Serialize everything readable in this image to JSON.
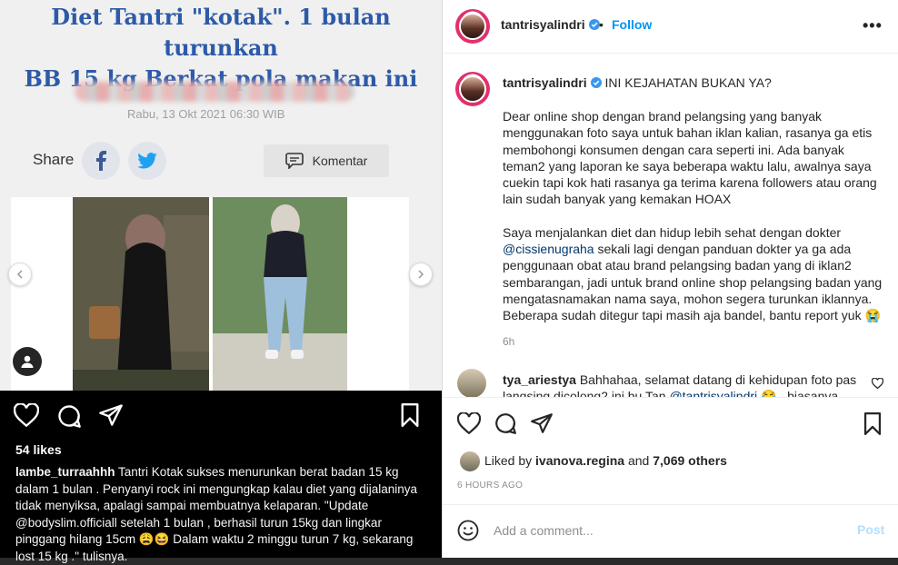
{
  "article": {
    "title_line1": "Diet Tantri \"kotak\". 1 bulan turunkan",
    "title_line2": "BB 15 kg Berkat pola makan ini",
    "date": "Rabu, 13 Okt 2021 06:30 WIB",
    "share_label": "Share",
    "komentar_label": "Komentar"
  },
  "left_post": {
    "likes": "54 likes",
    "caption_user": "lambe_turraahhh",
    "caption_text": " Tantri Kotak sukses menurunkan berat badan 15 kg dalam 1 bulan . Penyanyi rock ini mengungkap kalau diet yang dijalaninya tidak menyiksa, apalagi sampai membuatnya kelaparan. \"Update @bodyslim.officiall setelah 1 bulan , berhasil turun 15kg dan lingkar pinggang hilang 15cm 😩😆 Dalam waktu 2 minggu turun 7 kg, sekarang lost  15 kg .\" tulisnya."
  },
  "header": {
    "username": "tantrisyalindri",
    "separator": "•",
    "follow_label": "Follow",
    "more_label": "•••"
  },
  "caption": {
    "username": "tantrisyalindri",
    "headline": "INI KEJAHATAN BUKAN YA?",
    "para1": "Dear online shop dengan brand pelangsing yang banyak menggunakan foto saya untuk bahan iklan kalian, rasanya ga etis membohongi konsumen dengan cara seperti ini. Ada banyak teman2 yang laporan ke saya beberapa waktu lalu, awalnya saya cuekin tapi kok hati rasanya ga terima karena followers atau orang lain sudah banyak yang kemakan HOAX",
    "para2_before": "Saya menjalankan diet dan hidup lebih sehat dengan dokter ",
    "para2_mention": "@cissienugraha",
    "para2_after": " sekali lagi dengan panduan dokter ya ga ada penggunaan obat atau brand pelangsing badan yang di iklan2 sembarangan, jadi untuk brand online shop pelangsing badan yang mengatasnamakan nama saya, mohon segera turunkan iklannya. Beberapa sudah ditegur tapi masih aja bandel, bantu report yuk 😭",
    "time": "6h"
  },
  "comment": {
    "username": "tya_ariestya",
    "text_before": " Bahhahaa, selamat datang di kehidupan foto pas langsing dicolong2 ini bu Tan ",
    "mention": "@tantrisyalindri",
    "text_after": " 😂 , biasanya"
  },
  "actions": {
    "liked_by_prefix": "Liked by ",
    "liked_by_user": "ivanova.regina",
    "liked_by_mid": " and ",
    "liked_by_count": "7,069 others",
    "time_ago": "6 HOURS AGO"
  },
  "add_comment": {
    "placeholder": "Add a comment...",
    "post_label": "Post"
  },
  "colors": {
    "follow_blue": "#0095f6",
    "post_disabled": "#b2dffc",
    "verified_blue": "#3897f0",
    "article_title": "#2d5aa8"
  }
}
